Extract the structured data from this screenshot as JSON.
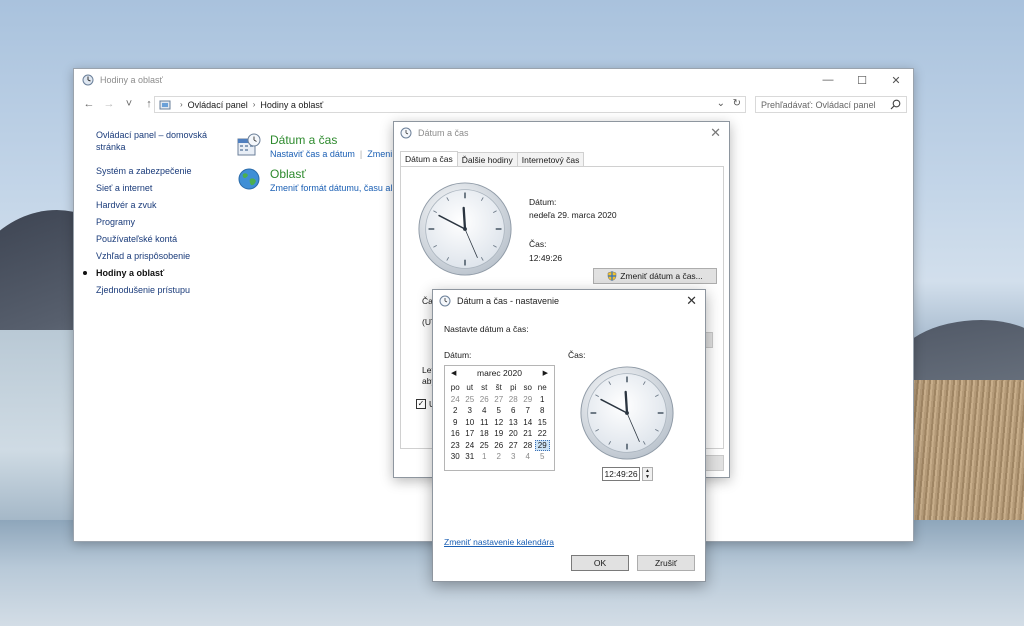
{
  "main_window": {
    "title": "Hodiny a oblasť",
    "controls": {
      "minimize": "—",
      "maximize": "☐",
      "close": "✕"
    },
    "nav": {
      "back": "←",
      "forward": "→",
      "recent": "˅",
      "up": "↑"
    },
    "breadcrumb": [
      "Ovládací panel",
      "Hodiny a oblasť"
    ],
    "search_placeholder": "Prehľadávať: Ovládací panel",
    "sidebar": {
      "home": "Ovládací panel – domovská stránka",
      "items": [
        "Systém a zabezpečenie",
        "Sieť a internet",
        "Hardvér a zvuk",
        "Programy",
        "Používateľské kontá",
        "Vzhľad a prispôsobenie",
        "Hodiny a oblasť",
        "Zjednodušenie prístupu"
      ],
      "active_index": 6
    },
    "categories": [
      {
        "title": "Dátum a čas",
        "links": [
          "Nastaviť čas a dátum",
          "Zmeni"
        ]
      },
      {
        "title": "Oblasť",
        "links": [
          "Zmeniť formát dátumu, času al"
        ]
      }
    ]
  },
  "dt_dialog": {
    "title": "Dátum a čas",
    "tabs": [
      "Dátum a čas",
      "Ďalšie hodiny",
      "Internetový čas"
    ],
    "date_label": "Dátum:",
    "date_value": "nedeľa 29. marca 2020",
    "time_label": "Čas:",
    "time_value": "12:49:26",
    "change_button": "Zmeniť dátum a čas...",
    "partial_texts": [
      "Časo",
      "(UTC",
      "Letn",
      "aby",
      "U"
    ]
  },
  "settings_dialog": {
    "title": "Dátum a čas - nastavenie",
    "heading": "Nastavte dátum a čas:",
    "date_label": "Dátum:",
    "time_label": "Čas:",
    "calendar": {
      "month": "marec 2020",
      "weekdays": [
        "po",
        "ut",
        "st",
        "št",
        "pi",
        "so",
        "ne"
      ],
      "weeks": [
        [
          "24",
          "25",
          "26",
          "27",
          "28",
          "29",
          "1"
        ],
        [
          "2",
          "3",
          "4",
          "5",
          "6",
          "7",
          "8"
        ],
        [
          "9",
          "10",
          "11",
          "12",
          "13",
          "14",
          "15"
        ],
        [
          "16",
          "17",
          "18",
          "19",
          "20",
          "21",
          "22"
        ],
        [
          "23",
          "24",
          "25",
          "26",
          "27",
          "28",
          "29"
        ],
        [
          "30",
          "31",
          "1",
          "2",
          "3",
          "4",
          "5"
        ]
      ],
      "selected_day": "29"
    },
    "time_value": "12:49:26",
    "calendar_link": "Zmeniť nastavenie kalendára",
    "ok": "OK",
    "cancel": "Zrušiť"
  },
  "colors": {
    "link": "#1a5fb4",
    "category_title": "#2d8a2d",
    "selected_day_bg": "#cde4f7"
  }
}
